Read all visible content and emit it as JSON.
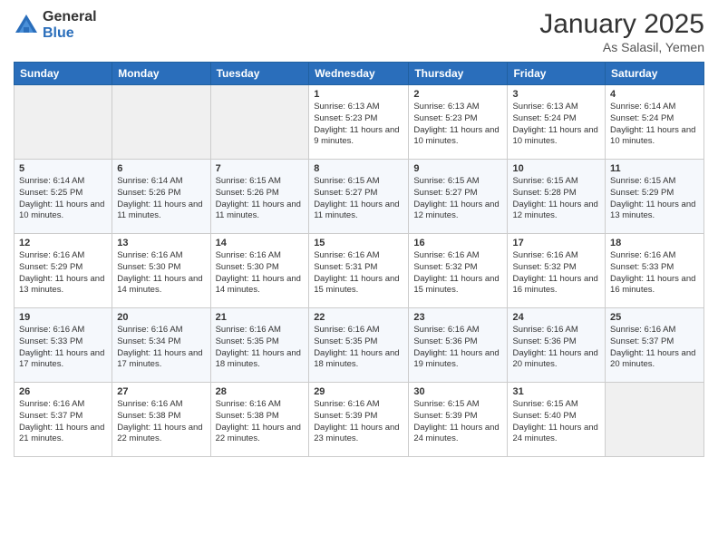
{
  "header": {
    "logo_general": "General",
    "logo_blue": "Blue",
    "month_title": "January 2025",
    "location": "As Salasil, Yemen"
  },
  "days_of_week": [
    "Sunday",
    "Monday",
    "Tuesday",
    "Wednesday",
    "Thursday",
    "Friday",
    "Saturday"
  ],
  "weeks": [
    [
      {
        "day": "",
        "info": ""
      },
      {
        "day": "",
        "info": ""
      },
      {
        "day": "",
        "info": ""
      },
      {
        "day": "1",
        "info": "Sunrise: 6:13 AM\nSunset: 5:23 PM\nDaylight: 11 hours and 9 minutes."
      },
      {
        "day": "2",
        "info": "Sunrise: 6:13 AM\nSunset: 5:23 PM\nDaylight: 11 hours and 10 minutes."
      },
      {
        "day": "3",
        "info": "Sunrise: 6:13 AM\nSunset: 5:24 PM\nDaylight: 11 hours and 10 minutes."
      },
      {
        "day": "4",
        "info": "Sunrise: 6:14 AM\nSunset: 5:24 PM\nDaylight: 11 hours and 10 minutes."
      }
    ],
    [
      {
        "day": "5",
        "info": "Sunrise: 6:14 AM\nSunset: 5:25 PM\nDaylight: 11 hours and 10 minutes."
      },
      {
        "day": "6",
        "info": "Sunrise: 6:14 AM\nSunset: 5:26 PM\nDaylight: 11 hours and 11 minutes."
      },
      {
        "day": "7",
        "info": "Sunrise: 6:15 AM\nSunset: 5:26 PM\nDaylight: 11 hours and 11 minutes."
      },
      {
        "day": "8",
        "info": "Sunrise: 6:15 AM\nSunset: 5:27 PM\nDaylight: 11 hours and 11 minutes."
      },
      {
        "day": "9",
        "info": "Sunrise: 6:15 AM\nSunset: 5:27 PM\nDaylight: 11 hours and 12 minutes."
      },
      {
        "day": "10",
        "info": "Sunrise: 6:15 AM\nSunset: 5:28 PM\nDaylight: 11 hours and 12 minutes."
      },
      {
        "day": "11",
        "info": "Sunrise: 6:15 AM\nSunset: 5:29 PM\nDaylight: 11 hours and 13 minutes."
      }
    ],
    [
      {
        "day": "12",
        "info": "Sunrise: 6:16 AM\nSunset: 5:29 PM\nDaylight: 11 hours and 13 minutes."
      },
      {
        "day": "13",
        "info": "Sunrise: 6:16 AM\nSunset: 5:30 PM\nDaylight: 11 hours and 14 minutes."
      },
      {
        "day": "14",
        "info": "Sunrise: 6:16 AM\nSunset: 5:30 PM\nDaylight: 11 hours and 14 minutes."
      },
      {
        "day": "15",
        "info": "Sunrise: 6:16 AM\nSunset: 5:31 PM\nDaylight: 11 hours and 15 minutes."
      },
      {
        "day": "16",
        "info": "Sunrise: 6:16 AM\nSunset: 5:32 PM\nDaylight: 11 hours and 15 minutes."
      },
      {
        "day": "17",
        "info": "Sunrise: 6:16 AM\nSunset: 5:32 PM\nDaylight: 11 hours and 16 minutes."
      },
      {
        "day": "18",
        "info": "Sunrise: 6:16 AM\nSunset: 5:33 PM\nDaylight: 11 hours and 16 minutes."
      }
    ],
    [
      {
        "day": "19",
        "info": "Sunrise: 6:16 AM\nSunset: 5:33 PM\nDaylight: 11 hours and 17 minutes."
      },
      {
        "day": "20",
        "info": "Sunrise: 6:16 AM\nSunset: 5:34 PM\nDaylight: 11 hours and 17 minutes."
      },
      {
        "day": "21",
        "info": "Sunrise: 6:16 AM\nSunset: 5:35 PM\nDaylight: 11 hours and 18 minutes."
      },
      {
        "day": "22",
        "info": "Sunrise: 6:16 AM\nSunset: 5:35 PM\nDaylight: 11 hours and 18 minutes."
      },
      {
        "day": "23",
        "info": "Sunrise: 6:16 AM\nSunset: 5:36 PM\nDaylight: 11 hours and 19 minutes."
      },
      {
        "day": "24",
        "info": "Sunrise: 6:16 AM\nSunset: 5:36 PM\nDaylight: 11 hours and 20 minutes."
      },
      {
        "day": "25",
        "info": "Sunrise: 6:16 AM\nSunset: 5:37 PM\nDaylight: 11 hours and 20 minutes."
      }
    ],
    [
      {
        "day": "26",
        "info": "Sunrise: 6:16 AM\nSunset: 5:37 PM\nDaylight: 11 hours and 21 minutes."
      },
      {
        "day": "27",
        "info": "Sunrise: 6:16 AM\nSunset: 5:38 PM\nDaylight: 11 hours and 22 minutes."
      },
      {
        "day": "28",
        "info": "Sunrise: 6:16 AM\nSunset: 5:38 PM\nDaylight: 11 hours and 22 minutes."
      },
      {
        "day": "29",
        "info": "Sunrise: 6:16 AM\nSunset: 5:39 PM\nDaylight: 11 hours and 23 minutes."
      },
      {
        "day": "30",
        "info": "Sunrise: 6:15 AM\nSunset: 5:39 PM\nDaylight: 11 hours and 24 minutes."
      },
      {
        "day": "31",
        "info": "Sunrise: 6:15 AM\nSunset: 5:40 PM\nDaylight: 11 hours and 24 minutes."
      },
      {
        "day": "",
        "info": ""
      }
    ]
  ]
}
